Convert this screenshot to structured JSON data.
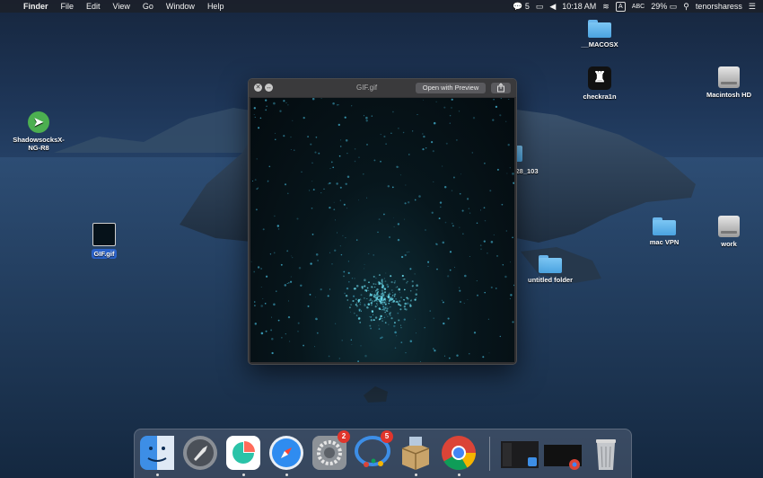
{
  "menubar": {
    "app_name": "Finder",
    "menus": [
      "File",
      "Edit",
      "View",
      "Go",
      "Window",
      "Help"
    ],
    "status": {
      "notifications_count": "5",
      "time": "10:18 AM",
      "input_label": "A",
      "input_source": "ABC",
      "battery": "29%",
      "username": "tenorsharess"
    }
  },
  "desktop": {
    "icons": [
      {
        "label": "__MACOSX"
      },
      {
        "label": "checkra1n"
      },
      {
        "label": "Macintosh HD"
      },
      {
        "label": "ShadowsocksX-\nNG-R8"
      },
      {
        "label": "28_103"
      },
      {
        "label": "GIF.gif"
      },
      {
        "label": "mac VPN"
      },
      {
        "label": "work"
      },
      {
        "label": "untitled folder"
      }
    ]
  },
  "quicklook": {
    "title": "GIF.gif",
    "open_button": "Open with Preview"
  },
  "dock": {
    "badges": {
      "system_preferences": "2",
      "messenger": "5"
    }
  }
}
